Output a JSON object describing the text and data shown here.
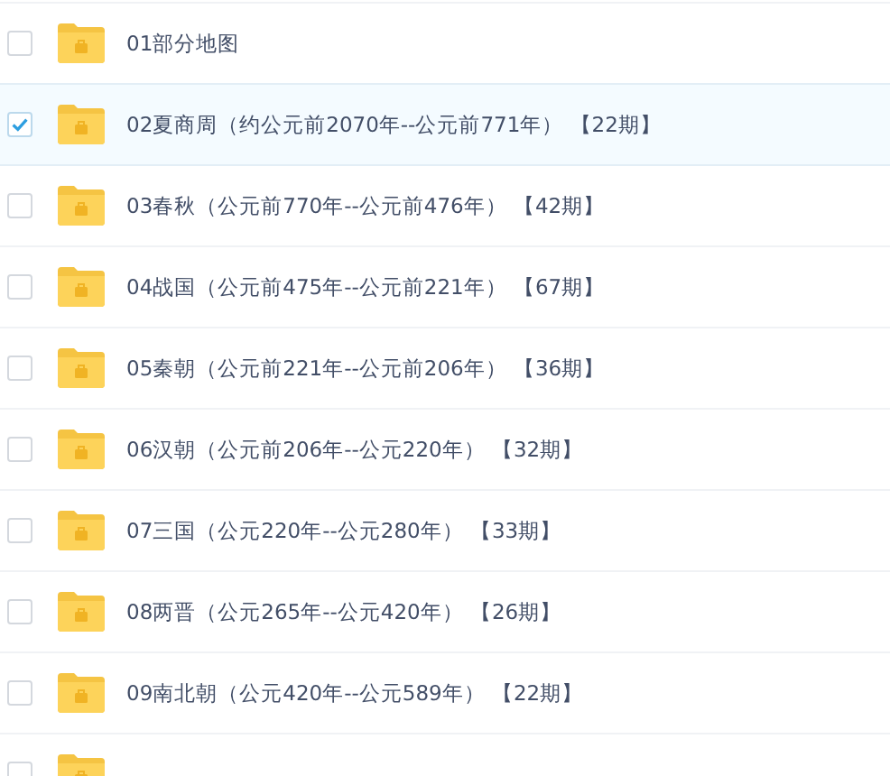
{
  "files": [
    {
      "name": "01部分地图",
      "checked": false
    },
    {
      "name": "02夏商周（约公元前2070年--公元前771年） 【22期】",
      "checked": true
    },
    {
      "name": "03春秋（公元前770年--公元前476年） 【42期】",
      "checked": false
    },
    {
      "name": "04战国（公元前475年--公元前221年） 【67期】",
      "checked": false
    },
    {
      "name": "05秦朝（公元前221年--公元前206年） 【36期】",
      "checked": false
    },
    {
      "name": "06汉朝（公元前206年--公元220年） 【32期】",
      "checked": false
    },
    {
      "name": "07三国（公元220年--公元280年） 【33期】",
      "checked": false
    },
    {
      "name": "08两晋（公元265年--公元420年） 【26期】",
      "checked": false
    },
    {
      "name": "09南北朝（公元420年--公元589年） 【22期】",
      "checked": false
    },
    {
      "checked": false
    }
  ]
}
